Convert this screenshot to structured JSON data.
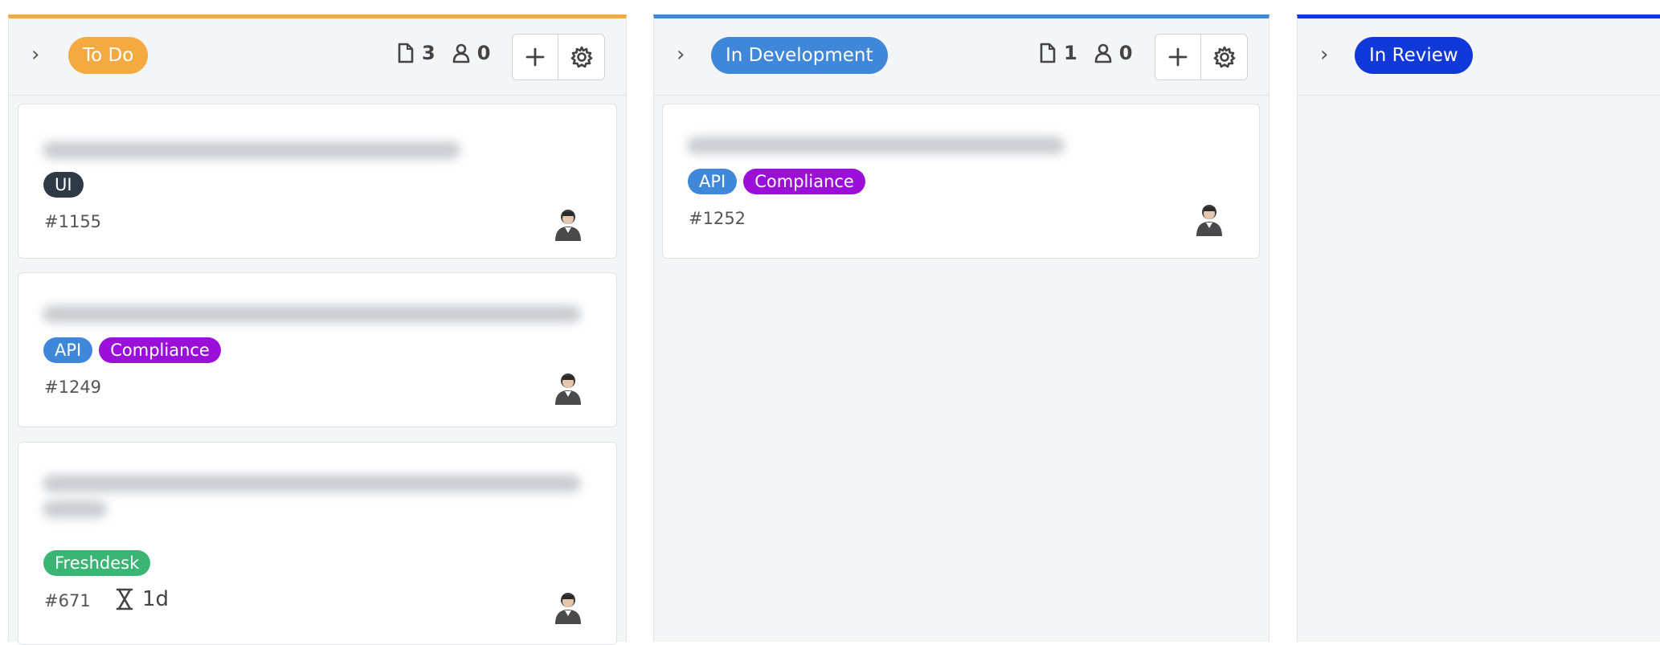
{
  "columns": [
    {
      "status": "To Do",
      "color": "#f5a941",
      "card_count": "3",
      "user_count": "0",
      "cards": [
        {
          "tags": [
            {
              "label": "UI",
              "color": "#2f3a46"
            }
          ],
          "id": "#1155"
        },
        {
          "tags": [
            {
              "label": "API",
              "color": "#3f87d8"
            },
            {
              "label": "Compliance",
              "color": "#9b10d8"
            }
          ],
          "id": "#1249"
        },
        {
          "tags": [
            {
              "label": "Freshdesk",
              "color": "#3bb574"
            }
          ],
          "id": "#671",
          "estimate": "1d"
        }
      ]
    },
    {
      "status": "In Development",
      "color": "#3f87d8",
      "card_count": "1",
      "user_count": "0",
      "cards": [
        {
          "tags": [
            {
              "label": "API",
              "color": "#3f87d8"
            },
            {
              "label": "Compliance",
              "color": "#9b10d8"
            }
          ],
          "id": "#1252"
        }
      ]
    },
    {
      "status": "In Review",
      "color": "#1138d9",
      "cards": []
    }
  ],
  "icons": {
    "expand": "chevron-right-icon",
    "cards": "card-icon",
    "users": "person-icon",
    "add": "plus-icon",
    "settings": "gear-icon",
    "estimate": "hourglass-icon"
  }
}
